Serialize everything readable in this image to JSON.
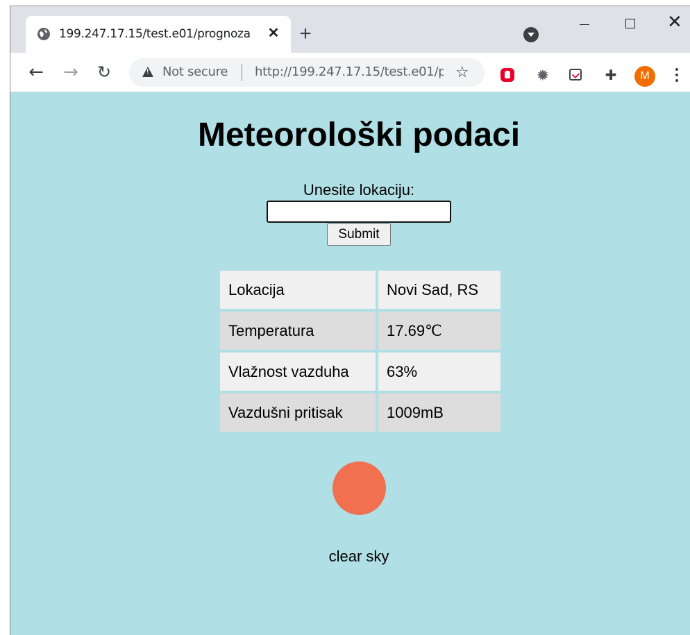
{
  "browser": {
    "tab_title": "199.247.17.15/test.e01/prognoza",
    "tab_close": "✕",
    "new_tab": "+",
    "security_label": "Not secure",
    "url": "http://199.247.17.15/test.e01/prognoza",
    "avatar_initial": "M"
  },
  "page": {
    "title": "Meteorološki podaci",
    "form": {
      "label": "Unesite lokaciju:",
      "input_value": "",
      "submit_label": "Submit"
    },
    "table": [
      {
        "label": "Lokacija",
        "value": "Novi Sad, RS"
      },
      {
        "label": "Temperatura",
        "value": "17.69℃"
      },
      {
        "label": "Vlažnost vazduha",
        "value": "63%"
      },
      {
        "label": "Vazdušni pritisak",
        "value": "1009mB"
      }
    ],
    "weather_icon": "sun-icon",
    "description": "clear sky"
  },
  "colors": {
    "page_background": "#b0dfe5",
    "sun": "#f0704f",
    "avatar": "#f06d00"
  }
}
